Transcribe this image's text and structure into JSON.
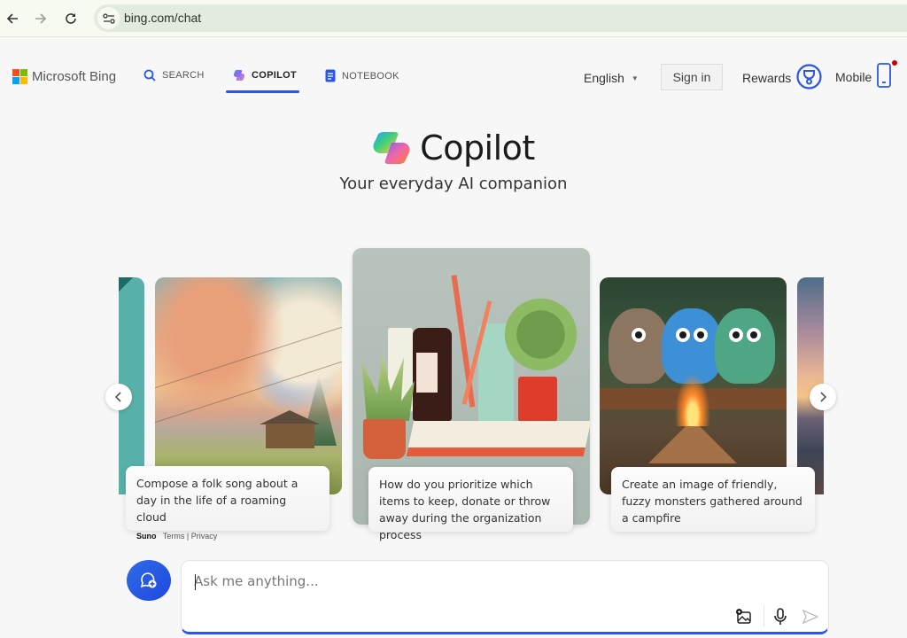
{
  "browser": {
    "url": "bing.com/chat",
    "back_icon": "arrow-left-icon",
    "forward_icon": "arrow-right-icon",
    "reload_icon": "reload-icon",
    "site_info_icon": "tune-icon"
  },
  "header": {
    "brand": "Microsoft Bing",
    "brand_colors": [
      "#f25022",
      "#7fba00",
      "#00a4ef",
      "#ffb900"
    ],
    "tabs": [
      {
        "label": "SEARCH",
        "icon": "search-icon",
        "active": false
      },
      {
        "label": "COPILOT",
        "icon": "copilot-icon",
        "active": true
      },
      {
        "label": "NOTEBOOK",
        "icon": "notebook-icon",
        "active": false
      }
    ],
    "language": "English",
    "sign_in": "Sign in",
    "rewards": "Rewards",
    "mobile": "Mobile",
    "accent": "#2a57e6"
  },
  "hero": {
    "title": "Copilot",
    "subtitle": "Your everyday AI companion"
  },
  "carousel": {
    "cards": [
      {
        "prompt": "Compose a folk song about a day in the life of a roaming cloud",
        "meta_brand": "Suno",
        "meta_terms": "Terms",
        "meta_separator": "|",
        "meta_privacy": "Privacy",
        "image": "watercolor clouds with musical notes over countryside"
      },
      {
        "prompt": "How do you prioritize which items to keep, donate or throw away during the organization process",
        "image": "bathroom bottles, toothbrushes and potted plants"
      },
      {
        "prompt": "Create an image of friendly, fuzzy monsters gathered around a campfire",
        "image": "three fuzzy monsters around a campfire in a forest"
      }
    ],
    "prev_icon": "chevron-left-icon",
    "next_icon": "chevron-right-icon"
  },
  "composer": {
    "placeholder": "Ask me anything...",
    "value": "",
    "new_topic_icon": "new-chat-icon",
    "image_icon": "add-image-icon",
    "mic_icon": "microphone-icon",
    "send_icon": "send-icon"
  }
}
